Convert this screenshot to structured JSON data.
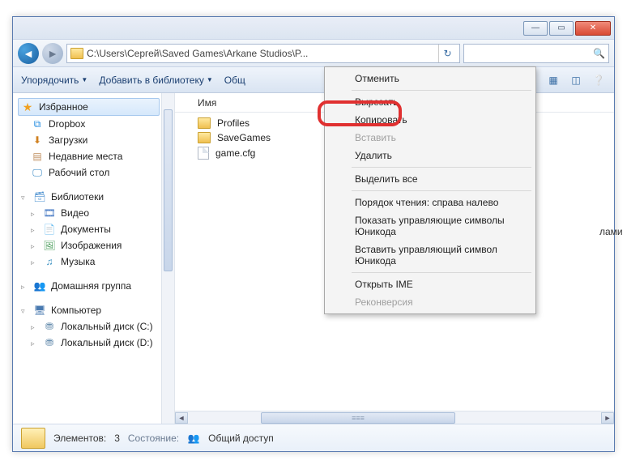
{
  "window": {
    "path": "C:\\Users\\Сергей\\Saved Games\\Arkane Studios\\P..."
  },
  "toolbar": {
    "organize": "Упорядочить",
    "addlib": "Добавить в библиотеку",
    "share": "Общ"
  },
  "sidebar": {
    "fav": "Избранное",
    "fav_items": [
      "Dropbox",
      "Загрузки",
      "Недавние места",
      "Рабочий стол"
    ],
    "lib": "Библиотеки",
    "lib_items": [
      "Видео",
      "Документы",
      "Изображения",
      "Музыка"
    ],
    "home": "Домашняя группа",
    "comp": "Компьютер",
    "comp_items": [
      "Локальный диск (C:)",
      "Локальный диск (D:)"
    ]
  },
  "columns": {
    "name": "Имя"
  },
  "files": [
    {
      "name": "Profiles",
      "type": "folder"
    },
    {
      "name": "SaveGames",
      "type": "folder"
    },
    {
      "name": "game.cfg",
      "type": "file"
    }
  ],
  "peek_text": "лами",
  "status": {
    "count_label": "Элементов:",
    "count": "3",
    "state_label": "Состояние:",
    "shared": "Общий доступ"
  },
  "context_menu": {
    "undo": "Отменить",
    "cut": "Вырезать",
    "copy": "Копировать",
    "paste": "Вставить",
    "delete": "Удалить",
    "select_all": "Выделить все",
    "rtl": "Порядок чтения: справа налево",
    "show_unicode": "Показать управляющие символы Юникода",
    "insert_unicode": "Вставить управляющий символ Юникода",
    "open_ime": "Открыть IME",
    "reconvert": "Реконверсия"
  }
}
